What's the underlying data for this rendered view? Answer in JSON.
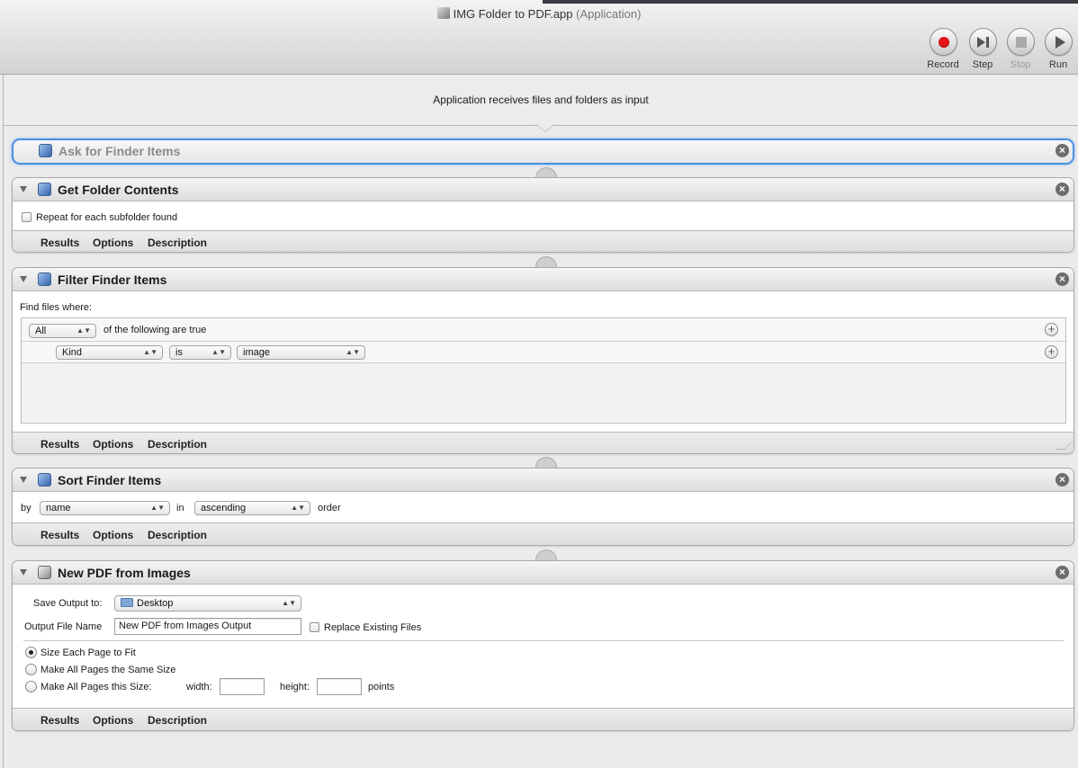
{
  "window": {
    "title": "IMG Folder to PDF.app",
    "subtitle": "(Application)"
  },
  "toolbar": {
    "record": "Record",
    "step": "Step",
    "stop": "Stop",
    "run": "Run"
  },
  "input_bar": {
    "text": "Application receives files and folders as input"
  },
  "actions": {
    "ask": {
      "title": "Ask for Finder Items"
    },
    "folder": {
      "title": "Get Folder Contents",
      "repeat_label": "Repeat for each subfolder found",
      "repeat_checked": false
    },
    "filter": {
      "title": "Filter Finder Items",
      "find_label": "Find files where:",
      "quantifier": "All",
      "following_text": "of the following are true",
      "criterion": {
        "attribute": "Kind",
        "operator": "is",
        "value": "image"
      }
    },
    "sort": {
      "title": "Sort Finder Items",
      "by_label": "by",
      "key": "name",
      "in_label": "in",
      "direction": "ascending",
      "order_label": "order"
    },
    "pdf": {
      "title": "New PDF from Images",
      "save_label": "Save Output to:",
      "save_value": "Desktop",
      "filename_label": "Output File Name",
      "filename_value": "New PDF from Images Output",
      "replace_label": "Replace Existing Files",
      "replace_checked": false,
      "size_fit": "Size Each Page to Fit",
      "size_same": "Make All Pages the Same Size",
      "size_custom": "Make All Pages this Size:",
      "selected_option": "Size Each Page to Fit",
      "width_label": "width:",
      "height_label": "height:",
      "points_label": "points"
    }
  },
  "footer_tabs": {
    "results": "Results",
    "options": "Options",
    "description": "Description"
  }
}
